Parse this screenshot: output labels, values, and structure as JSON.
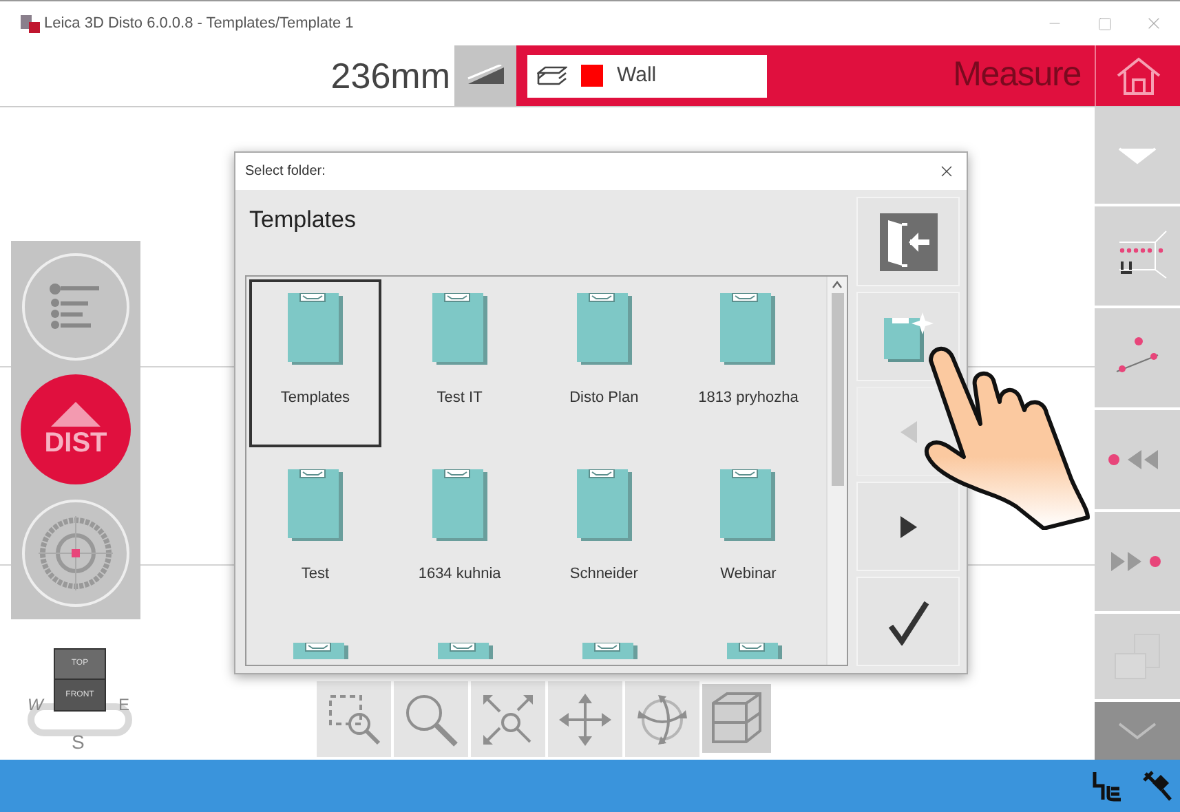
{
  "window": {
    "title": "Leica 3D Disto 6.0.0.8 - Templates/Template 1"
  },
  "toolbar": {
    "measurement": "236mm",
    "layer": {
      "name": "Wall",
      "color": "#ff0000"
    },
    "mode": "Measure"
  },
  "left_panel": {
    "dist_label": "DIST"
  },
  "compass": {
    "top": "TOP",
    "front": "FRONT",
    "west": "W",
    "east": "E",
    "south": "S"
  },
  "dialog": {
    "title": "Select folder:",
    "heading": "Templates",
    "folders": [
      {
        "kind": "folder",
        "name": "Templates",
        "selected": true
      },
      {
        "kind": "folder",
        "name": "Test IT",
        "selected": false
      },
      {
        "kind": "folder",
        "name": "Disto Plan",
        "selected": false
      },
      {
        "kind": "folder",
        "name": "1813 pryhozha",
        "selected": false
      },
      {
        "kind": "folder",
        "name": "Test",
        "selected": false
      },
      {
        "kind": "folder",
        "name": "1634 kuhnia",
        "selected": false
      },
      {
        "kind": "folder",
        "name": "Schneider",
        "selected": false
      },
      {
        "kind": "folder",
        "name": "Webinar",
        "selected": false
      },
      {
        "kind": "partial"
      },
      {
        "kind": "partial"
      },
      {
        "kind": "partial"
      },
      {
        "kind": "partial"
      }
    ],
    "actions": [
      {
        "kind": "exit",
        "disabled": false
      },
      {
        "kind": "new-folder",
        "disabled": false
      },
      {
        "kind": "previous",
        "disabled": true
      },
      {
        "kind": "next",
        "disabled": false
      },
      {
        "kind": "confirm",
        "disabled": false
      }
    ]
  },
  "view_tools": [
    {
      "kind": "zoom-window",
      "selected": false
    },
    {
      "kind": "zoom",
      "selected": false
    },
    {
      "kind": "zoom-extents",
      "selected": false
    },
    {
      "kind": "pan",
      "selected": false
    },
    {
      "kind": "orbit",
      "selected": false
    },
    {
      "kind": "box-view",
      "selected": true
    }
  ],
  "sidebar": [
    {
      "kind": "collapse"
    },
    {
      "kind": "scan"
    },
    {
      "kind": "point-line"
    },
    {
      "kind": "rewind"
    },
    {
      "kind": "forward"
    },
    {
      "kind": "views"
    },
    {
      "kind": "expand"
    }
  ]
}
